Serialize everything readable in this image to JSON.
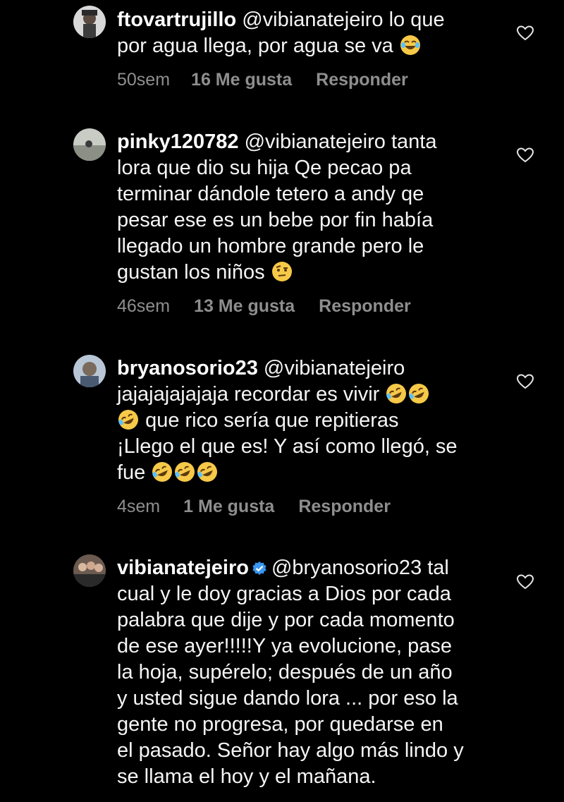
{
  "comments": [
    {
      "username": "ftovartrujillo",
      "lines": [
        "@vibianatejeiro lo que",
        "por agua llega, por agua se va"
      ],
      "time": "50sem",
      "likes": "16 Me gusta",
      "reply": "Responder"
    },
    {
      "username": "pinky120782",
      "lines": [
        "@vibianatejeiro tanta",
        "lora que dio su hija Qe pecao pa",
        "terminar dándole tetero a andy qe",
        "pesar ese es un bebe por fin había",
        "llegado un hombre grande pero le",
        "gustan los niños"
      ],
      "time": "46sem",
      "likes": "13 Me gusta",
      "reply": "Responder"
    },
    {
      "username": "bryanosorio23",
      "lines": [
        "@vibianatejeiro",
        "jajajajajajaja recordar es vivir",
        "que rico sería que repitieras",
        "¡Llego el que es! Y así como llegó, se",
        "fue"
      ],
      "time": "4sem",
      "likes": "1 Me gusta",
      "reply": "Responder"
    },
    {
      "username": "vibianatejeiro",
      "verified": true,
      "lines": [
        "@bryanosorio23 tal",
        "cual y le doy gracias a Dios por cada",
        "palabra que dije y por cada momento",
        "de ese ayer!!!!!Y ya evolucione, pase",
        "la hoja, supérelo; después de un año",
        "y usted sigue dando lora ... por eso la",
        "gente no progresa, por quedarse en",
        "el pasado. Señor hay algo más lindo y",
        "se llama el hoy y el mañana."
      ]
    }
  ],
  "icons": {
    "like": "heart-outline-icon",
    "verified": "verified-badge-icon",
    "emoji_laugh": "face-with-tears-of-joy",
    "emoji_rofl": "rolling-on-the-floor-laughing",
    "emoji_skeptical": "face-with-raised-eyebrow"
  },
  "colors": {
    "background": "#000000",
    "text": "#f5f5f5",
    "meta": "#8e8e8e",
    "verified": "#3897f0"
  }
}
